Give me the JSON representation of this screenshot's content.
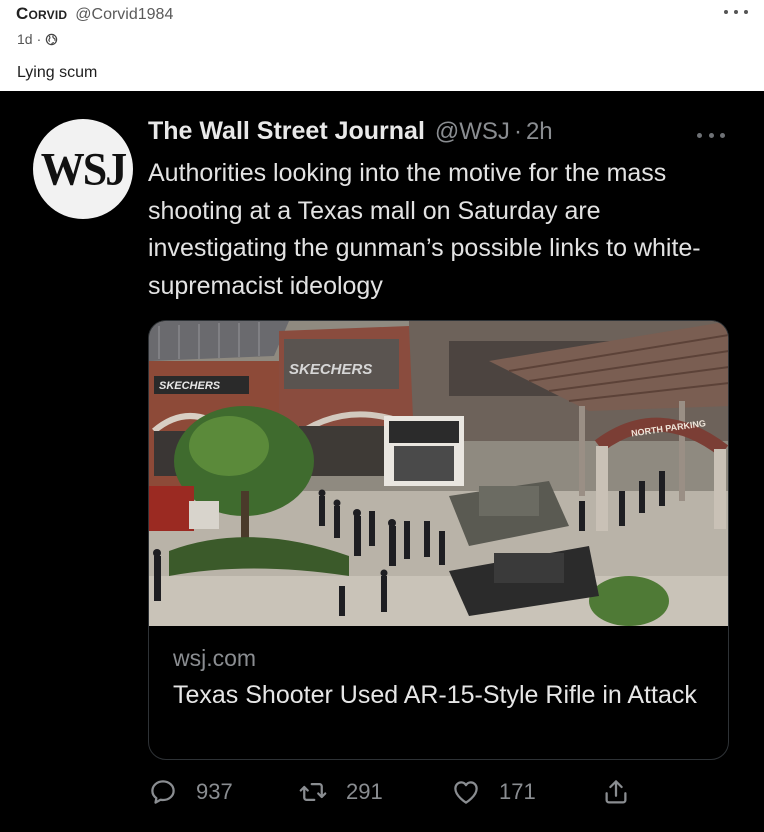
{
  "post": {
    "author_name": "Corvid",
    "author_handle": "@Corvid1984",
    "age": "1d",
    "separator": "·",
    "text": "Lying scum",
    "more_icon": "ellipsis-icon",
    "visibility_icon": "globe-icon"
  },
  "tweet": {
    "avatar_text": "WSJ",
    "name": "The Wall Street Journal",
    "handle": "@WSJ",
    "separator": "·",
    "time": "2h",
    "text": "Authorities looking into the motive for the mass shooting at a Texas mall on Saturday are investigating the gunman’s possible links to white-supremacist ideology",
    "card": {
      "image_text": {
        "store_sign_1": "SKECHERS",
        "store_sign_2": "SKECHERS",
        "parking_sign": "NORTH PARKING"
      },
      "domain": "wsj.com",
      "title": "Texas Shooter Used AR-15-Style Rifle in Attack"
    },
    "actions": {
      "replies": "937",
      "retweets": "291",
      "likes": "171"
    }
  },
  "colors": {
    "tweet_background": "#000000",
    "tweet_text": "#e3e3e3",
    "tweet_secondary": "#8a8d91",
    "card_border": "#2e3236"
  }
}
